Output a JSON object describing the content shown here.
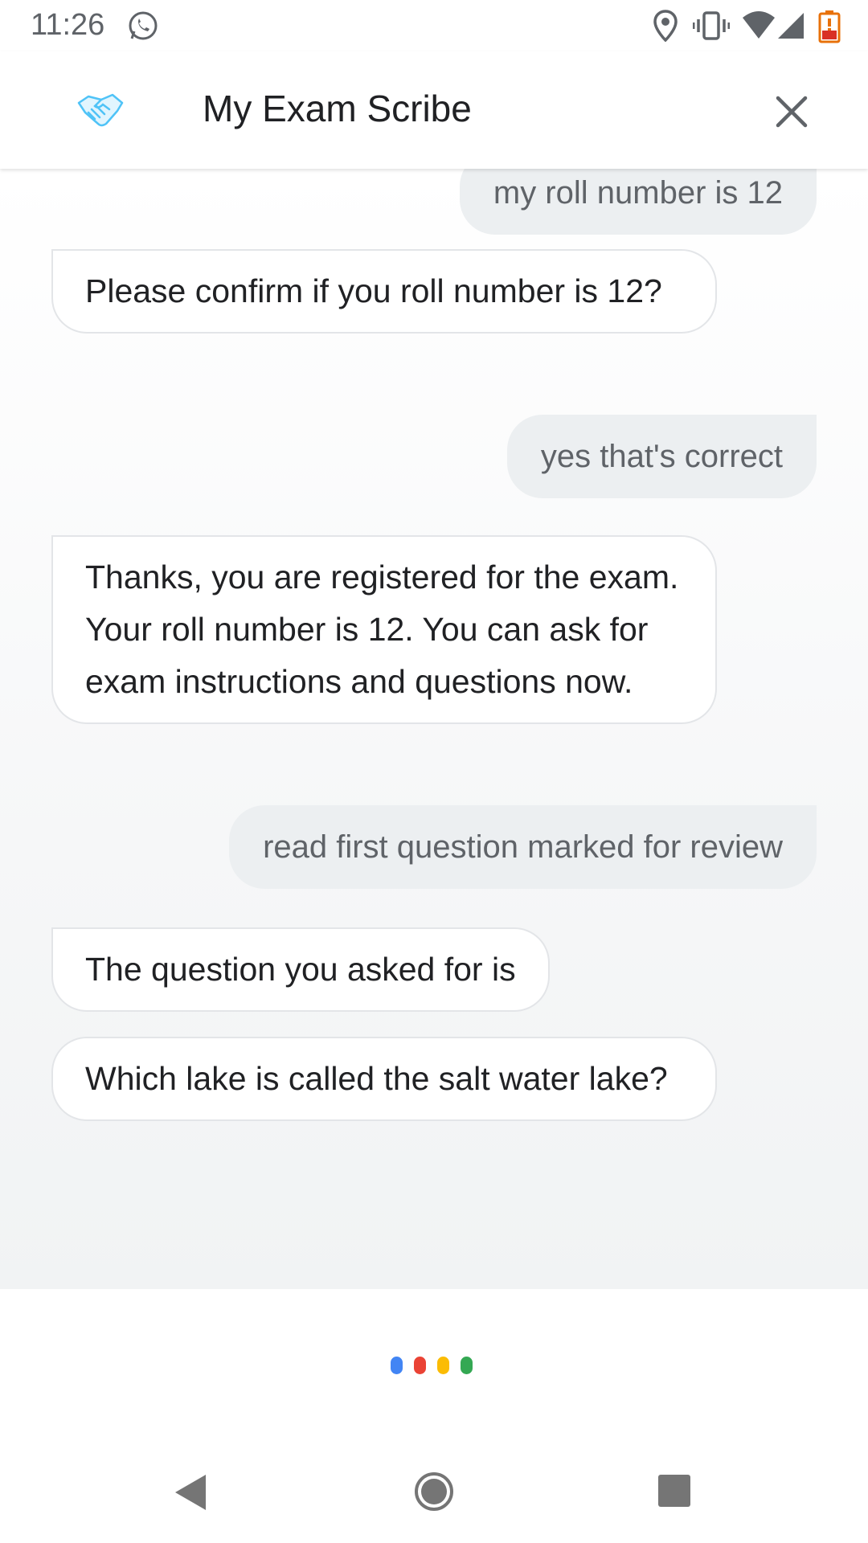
{
  "status_bar": {
    "time": "11:26",
    "icons": [
      "whatsapp-icon",
      "location-icon",
      "vibrate-icon",
      "wifi-icon",
      "signal-icon",
      "battery-low-icon"
    ]
  },
  "app_bar": {
    "title": "My Exam Scribe",
    "logo_icon": "handshake-icon",
    "close_icon": "close-icon"
  },
  "messages": [
    {
      "from": "user",
      "text": "my roll number is 12"
    },
    {
      "from": "bot",
      "text": "Please confirm if you roll number is 12?"
    },
    {
      "from": "user",
      "text": "yes that's correct"
    },
    {
      "from": "bot",
      "text": "Thanks, you are registered for the exam. Your roll number is 12. You can ask for exam instructions and questions now."
    },
    {
      "from": "user",
      "text": "read first question marked for review"
    },
    {
      "from": "bot",
      "text": "The question you asked for is"
    },
    {
      "from": "bot",
      "text": "Which lake is called the salt water lake?"
    }
  ],
  "assistant_dots": {
    "colors": [
      "#4285f4",
      "#ea4335",
      "#fbbc04",
      "#34a853"
    ]
  },
  "nav_bar": {
    "icons": [
      "back-icon",
      "home-icon",
      "recents-icon"
    ]
  },
  "colors": {
    "user_bubble": "#eceff1",
    "bot_bubble": "#ffffff",
    "text_primary": "#202124",
    "text_secondary": "#5f6368"
  }
}
